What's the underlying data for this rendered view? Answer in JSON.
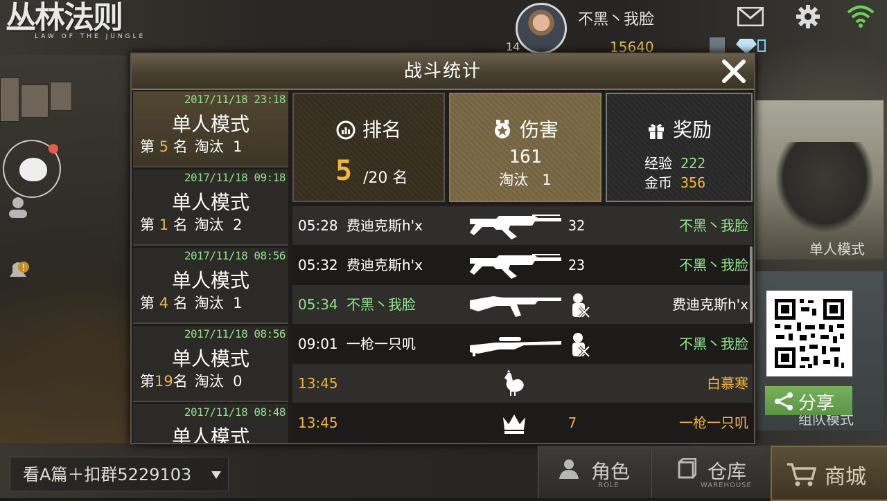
{
  "logo": {
    "title": "丛林法则",
    "subtitle": "LAW OF THE JUNGLE"
  },
  "profile": {
    "username": "不黑丶我脸",
    "level": "14",
    "coins": "15640"
  },
  "dialog": {
    "title": "战斗统计",
    "matches": [
      {
        "time": "2017/11/18 23:18",
        "mode": "单人模式",
        "rank_prefix": "第",
        "rank": "5",
        "rank_suffix": "名",
        "elim_label": "淘汰",
        "elim": "1",
        "selected": true
      },
      {
        "time": "2017/11/18 09:18",
        "mode": "单人模式",
        "rank_prefix": "第",
        "rank": "1",
        "rank_suffix": "名",
        "elim_label": "淘汰",
        "elim": "2"
      },
      {
        "time": "2017/11/18 08:56",
        "mode": "单人模式",
        "rank_prefix": "第",
        "rank": "4",
        "rank_suffix": "名",
        "elim_label": "淘汰",
        "elim": "1"
      },
      {
        "time": "2017/11/18 08:56",
        "mode": "单人模式",
        "rank_prefix": "第",
        "rank": "19",
        "rank_suffix": "名",
        "elim_label": "淘汰",
        "elim": "0"
      },
      {
        "time": "2017/11/18 08:48",
        "mode": "单人模式",
        "rank_prefix": "第",
        "rank": "",
        "rank_suffix": "",
        "elim_label": "",
        "elim": ""
      }
    ],
    "stats": {
      "rank": {
        "label": "排名",
        "value": "5",
        "total": "/20 名"
      },
      "damage": {
        "label": "伤害",
        "value": "161",
        "elim_label": "淘汰",
        "elim": "1"
      },
      "reward": {
        "label": "奖励",
        "exp_label": "经验",
        "exp": "222",
        "gold_label": "金币",
        "gold": "356"
      }
    },
    "feed": [
      {
        "time": "05:28",
        "killer": "费迪克斯h'x",
        "weapon": "assault-rifle-icon",
        "distance": "32",
        "victim": "不黑丶我脸",
        "time_color": "white",
        "killer_color": "white",
        "victim_color": "green"
      },
      {
        "time": "05:32",
        "killer": "费迪克斯h'x",
        "weapon": "assault-rifle-icon",
        "distance": "23",
        "victim": "不黑丶我脸",
        "time_color": "white",
        "killer_color": "white",
        "victim_color": "green"
      },
      {
        "time": "05:34",
        "killer": "不黑丶我脸",
        "weapon": "ak-rifle-icon",
        "distance": "",
        "victim": "费迪克斯h'x",
        "time_color": "green",
        "killer_color": "green",
        "victim_color": "white"
      },
      {
        "time": "09:01",
        "killer": "一枪一只叽",
        "weapon": "sniper-rifle-icon",
        "distance": "",
        "victim": "不黑丶我脸",
        "time_color": "white",
        "killer_color": "white",
        "victim_color": "green"
      },
      {
        "time": "13:45",
        "killer": "",
        "weapon": "chicken-icon",
        "distance": "",
        "victim": "白慕寒",
        "time_color": "yellow",
        "killer_color": "yellow",
        "victim_color": "yellow"
      },
      {
        "time": "13:45",
        "killer": "",
        "weapon": "crown-icon",
        "distance": "7",
        "victim": "一枪一只叽",
        "time_color": "yellow",
        "killer_color": "yellow",
        "victim_color": "yellow"
      }
    ]
  },
  "side": {
    "solo_label": "单人模式",
    "team_label": "组队模式",
    "share_label": "分享"
  },
  "bottom": {
    "chat_text": "看A篇＋扣群5229103",
    "role_label": "角色",
    "role_sub": "ROLE",
    "warehouse_label": "仓库",
    "warehouse_sub": "WAREHOUSE",
    "shop_label": "商城"
  },
  "colors": {
    "green": "#8fe38a",
    "yellow": "#f0b640",
    "header": "#6a5f4b"
  }
}
